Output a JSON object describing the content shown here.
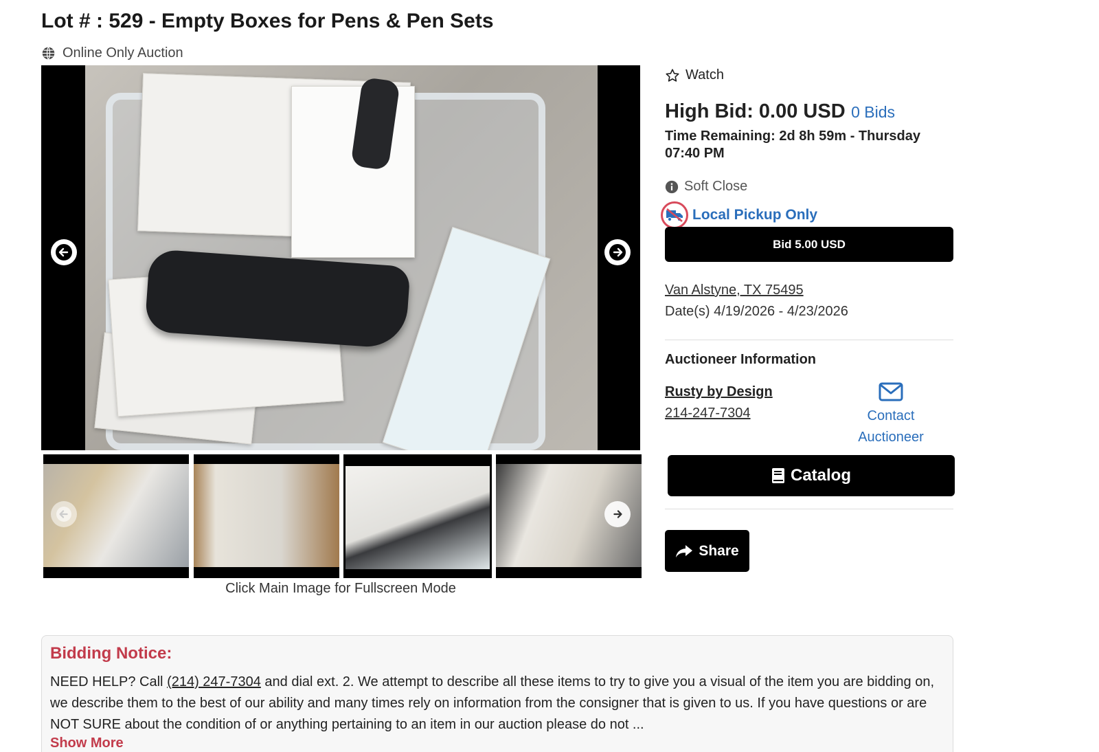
{
  "lot": {
    "title": "Lot # : 529 - Empty Boxes for Pens & Pen Sets",
    "auction_type": "Online Only Auction"
  },
  "gallery": {
    "caption": "Click Main Image for Fullscreen Mode",
    "thumbnail_count": 4,
    "active_thumbnail": 3
  },
  "bidding": {
    "watch_label": "Watch",
    "high_bid": "High Bid: 0.00 USD",
    "bids_link": "0 Bids",
    "time_remaining": "Time Remaining: 2d 8h 59m - Thursday 07:40 PM",
    "soft_close": "Soft Close",
    "pickup": "Local Pickup Only",
    "bid_button": "Bid 5.00 USD"
  },
  "location": {
    "address": "Van Alstyne, TX 75495",
    "dates": "Date(s) 4/19/2026 - 4/23/2026"
  },
  "auctioneer": {
    "heading": "Auctioneer Information",
    "name": "Rusty by Design",
    "phone": "214-247-7304",
    "contact_line1": "Contact",
    "contact_line2": "Auctioneer"
  },
  "actions": {
    "catalog": "Catalog",
    "share": "Share"
  },
  "notice": {
    "title": "Bidding Notice:",
    "text_before_phone": "NEED HELP? Call ",
    "phone": "(214) 247-7304",
    "text_after_phone": " and dial ext. 2. We attempt to describe all these items to try to give you a visual of the item you are bidding on, we describe them to the best of our ability and many times rely on information from the consigner that is given to us. If you have questions or are NOT SURE about the condition of or anything pertaining to an item in our auction please do not ...",
    "show_more": "Show More"
  },
  "colors": {
    "link_blue": "#2a6ebb",
    "notice_red": "#c23b4b",
    "button_black": "#000000"
  }
}
